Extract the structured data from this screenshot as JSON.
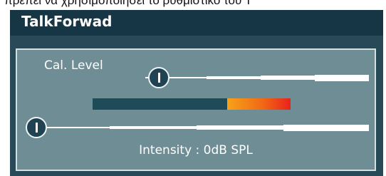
{
  "partial_text": "πρέπει να χρησιμοποιήσει το ρυθμιστικό του Τ",
  "window": {
    "title": "TalkForwad"
  },
  "panel": {
    "cal_label": "Cal. Level",
    "intensity_label": "Intensity : 0dB SPL",
    "cal_level_slider": {
      "value": 0.0
    },
    "level_meter": {
      "start": 0.68,
      "end": 1.0
    },
    "intensity_slider": {
      "value": 0.0
    }
  },
  "colors": {
    "title_bar": "#173645",
    "window_bg": "#284a58",
    "panel_bg": "#6f8d95",
    "meter_hot_start": "#f6a21a",
    "meter_hot_end": "#e8221d"
  }
}
